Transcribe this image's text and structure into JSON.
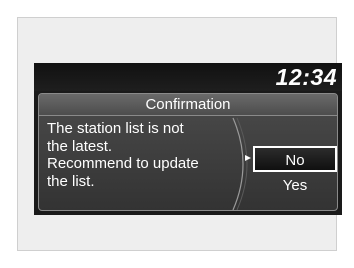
{
  "clock": {
    "time": "12:34"
  },
  "dialog": {
    "title": "Confirmation",
    "message_lines": [
      "The station list is not",
      "the latest.",
      "Recommend to update",
      "the list."
    ],
    "selected_option": "No",
    "options": [
      {
        "label": "No"
      },
      {
        "label": "Yes"
      }
    ]
  },
  "colors": {
    "screen_background": "#1a1a1a",
    "dialog_background": "#3d3d3d",
    "text": "#ffffff",
    "selection_border": "#ffffff"
  }
}
